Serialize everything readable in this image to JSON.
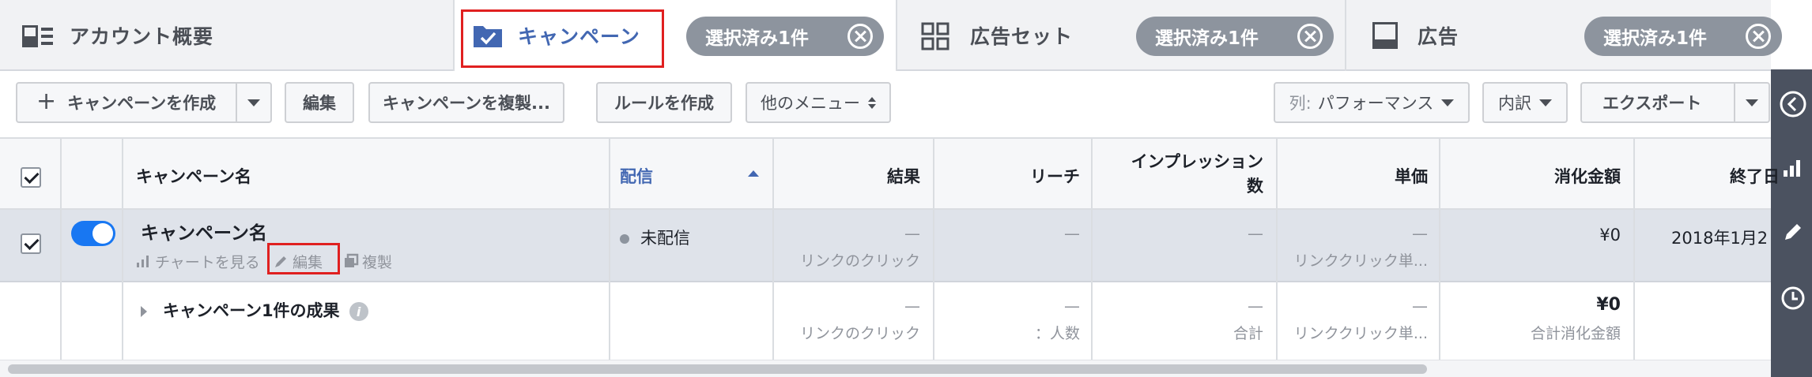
{
  "tabs": {
    "account": {
      "label": "アカウント概要",
      "icon": "account-overview-icon"
    },
    "campaign": {
      "label": "キャンペーン",
      "icon": "checked-folder-icon"
    },
    "adset": {
      "label": "広告セット",
      "icon": "grid-icon",
      "chip": "選択済み1件"
    },
    "ad": {
      "label": "広告",
      "icon": "ad-icon",
      "chip": "選択済み1件"
    },
    "campaign_chip": "選択済み1件"
  },
  "toolbar": {
    "create_campaign": "キャンペーンを作成",
    "edit": "編集",
    "duplicate": "キャンペーンを複製...",
    "create_rule": "ルールを作成",
    "more_menu": "他のメニュー",
    "columns_prefix": "列:",
    "columns_value": "パフォーマンス",
    "breakdown": "内訳",
    "export": "エクスポート"
  },
  "table": {
    "headers": {
      "name": "キャンペーン名",
      "delivery": "配信",
      "results": "結果",
      "reach": "リーチ",
      "impressions_line1": "インプレッション",
      "impressions_line2": "数",
      "cost": "単価",
      "spend": "消化金額",
      "end": "終了日"
    },
    "row1": {
      "name": "キャンペーン名",
      "action_chart": "チャートを見る",
      "action_edit": "編集",
      "action_duplicate": "複製",
      "delivery": "未配信",
      "results": "—",
      "results_sub": "リンクのクリック",
      "reach": "—",
      "impressions": "—",
      "cost": "—",
      "cost_sub": "リンククリック単...",
      "spend": "¥0",
      "end": "2018年1月2"
    },
    "row2": {
      "name": "キャンペーン1件の成果",
      "results": "—",
      "results_sub": "リンクのクリック",
      "reach": "—",
      "reach_sub": "：人数",
      "impressions": "—",
      "impressions_sub": "合計",
      "cost": "—",
      "cost_sub": "リンククリック単...",
      "spend": "¥0",
      "spend_sub": "合計消化金額"
    }
  },
  "colors": {
    "accent": "#4267b2",
    "highlight": "#e02020",
    "toggle_on": "#1877f2",
    "chip": "#8d949e",
    "rail": "#4b5260"
  }
}
